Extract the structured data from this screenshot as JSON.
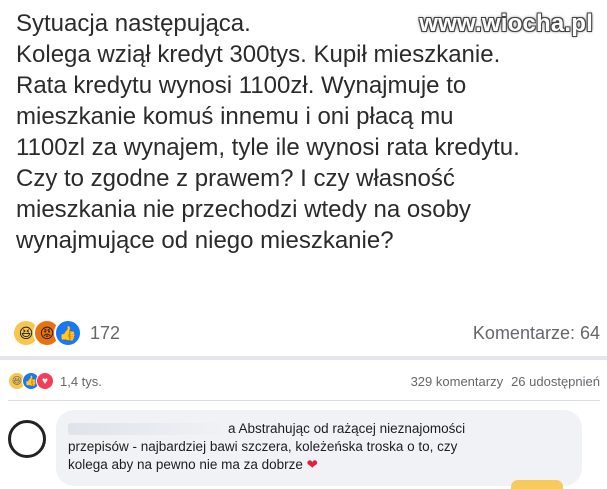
{
  "watermark": "www.wiocha.pl",
  "post": {
    "lines": [
      "Sytuacja następująca.",
      "Kolega wziął kredyt 300tys. Kupił mieszkanie.",
      "Rata kredytu wynosi 1100zł. Wynajmuje to",
      "mieszkanie komuś innemu i oni płacą mu",
      "1100zl za wynajem, tyle ile wynosi rata kredytu.",
      "Czy to zgodne z prawem? I czy własność",
      "mieszkania nie przechodzi wtedy na osoby",
      "wynajmujące od niego mieszkanie?"
    ]
  },
  "reactions": {
    "icons": [
      "haha-icon",
      "angry-icon",
      "like-icon"
    ],
    "count": "172",
    "comments_label": "Komentarze: 64"
  },
  "stats": {
    "icons": [
      "haha-icon",
      "like-icon",
      "love-icon"
    ],
    "likes": "1,4 tys.",
    "comments": "329 komentarzy",
    "shares": "26 udostępnień"
  },
  "comment": {
    "author_fragment": "a",
    "lines": [
      "Abstrahując od rażącej nieznajomości",
      "przepisów - najbardziej bawi szczera, koleżeńska troska o to, czy",
      "kolega aby na pewno nie ma za dobrze"
    ],
    "emoji": "❤"
  },
  "colors": {
    "like_blue": "#1877f2",
    "haha_yellow": "#f7c64a",
    "angry_orange": "#e9710f",
    "love_red": "#f33e58",
    "bubble_bg": "#f0f2f5"
  }
}
